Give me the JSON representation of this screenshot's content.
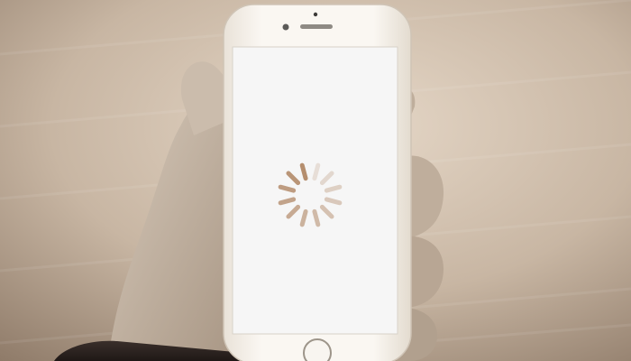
{
  "scene": {
    "background_color": "#c7b6a4",
    "device": "smartphone",
    "device_color": "#f5f1ea",
    "screen_color": "#f6f6f6",
    "hand": "left-hand-holding-phone"
  },
  "screen": {
    "state": "loading",
    "indicator": "spinner-icon",
    "spinner_color": "#b58e6e",
    "spokes": 12
  }
}
